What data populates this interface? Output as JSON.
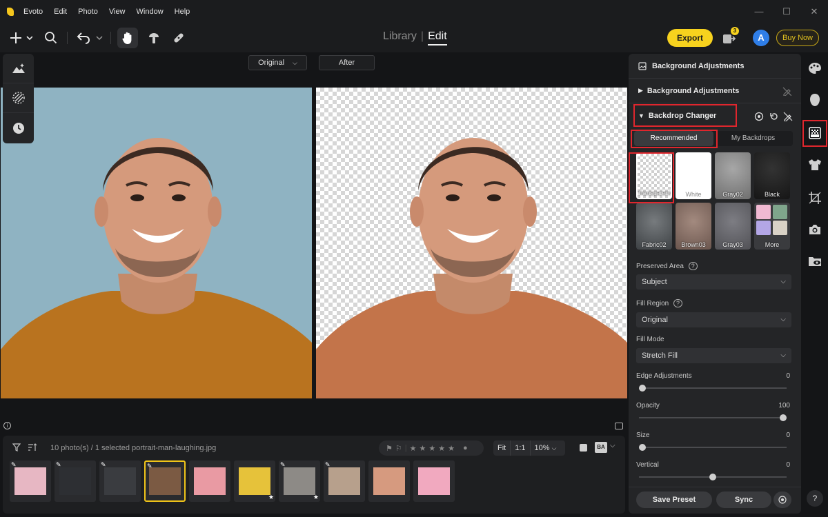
{
  "app": {
    "menu": [
      "Evoto",
      "Edit",
      "Photo",
      "View",
      "Window",
      "Help"
    ],
    "window_controls": [
      "—",
      "☐",
      "✕"
    ]
  },
  "toolbar": {
    "library_label": "Library",
    "edit_label": "Edit",
    "export_label": "Export",
    "badge_count": "3",
    "avatar_letter": "A",
    "buy_now_label": "Buy Now"
  },
  "view": {
    "original_label": "Original",
    "after_label": "After"
  },
  "filmstrip": {
    "count_text": "10 photo(s) / 1 selected",
    "filename": "portrait-man-laughing.jpg",
    "zoom_fit": "Fit",
    "zoom_one": "1:1",
    "zoom_pct": "10%",
    "compare_badge": "BA"
  },
  "panel": {
    "header_title": "Background Adjustments",
    "section_title": "Background Adjustments",
    "backdrop_title": "Backdrop Changer",
    "tabs": [
      "Recommended",
      "My Backdrops"
    ],
    "swatches": [
      {
        "label": "Transparent",
        "color": "#e8e8e8"
      },
      {
        "label": "White",
        "color": "#ffffff"
      },
      {
        "label": "Gray02",
        "color": "#8d8d8d"
      },
      {
        "label": "Black",
        "color": "#222222"
      },
      {
        "label": "Fabric02",
        "color": "#5b5f62"
      },
      {
        "label": "Brown03",
        "color": "#8e7469"
      },
      {
        "label": "Gray03",
        "color": "#6b6b70"
      },
      {
        "label": "More",
        "color": "#c9b7d7"
      }
    ],
    "preserved_area_label": "Preserved Area",
    "preserved_area_value": "Subject",
    "fill_region_label": "Fill Region",
    "fill_region_value": "Original",
    "fill_mode_label": "Fill Mode",
    "fill_mode_value": "Stretch Fill",
    "sliders": [
      {
        "label": "Edge Adjustments",
        "value": "0",
        "level": 0
      },
      {
        "label": "Opacity",
        "value": "100",
        "level": 1
      },
      {
        "label": "Size",
        "value": "0",
        "level": 0
      },
      {
        "label": "Vertical",
        "value": "0",
        "level": 0.5
      }
    ],
    "save_preset_label": "Save Preset",
    "sync_label": "Sync"
  },
  "colors": {
    "accent": "#f7d21e",
    "highlight": "#e0262d"
  }
}
